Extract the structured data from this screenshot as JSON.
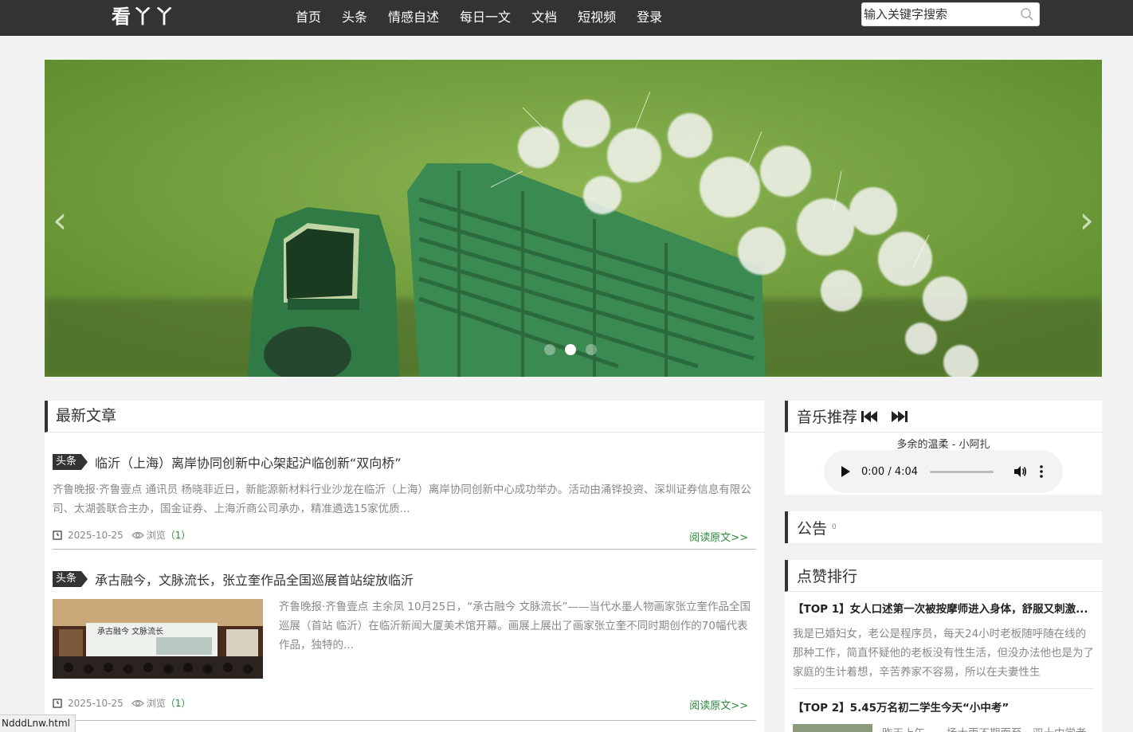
{
  "header": {
    "logo": "看丫丫",
    "nav": [
      "首页",
      "头条",
      "情感自述",
      "每日一文",
      "文档",
      "短视频",
      "登录"
    ],
    "search": {
      "placeholder": "输入关键字搜索"
    }
  },
  "slider": {
    "prev": "‹",
    "next": "›",
    "dot_count": 3,
    "active_dot": 2
  },
  "latest": {
    "title": "最新文章",
    "articles": [
      {
        "tag": "头条",
        "title": "临沂（上海）离岸协同创新中心架起沪临创新“双向桥”",
        "summary": "齐鲁晚报·齐鲁壹点 通讯员 杨晓菲近日，新能源新材料行业沙龙在临沂（上海）离岸协同创新中心成功举办。活动由涌铧投资、深圳证券信息有限公司、太湖荟联合主办，国金证券、上海沂商公司承办，精准遴选15家优质...",
        "date": "2025-10-25",
        "views_label": "浏览",
        "views": "（1）",
        "read_more": "阅读原文>>"
      },
      {
        "tag": "头条",
        "title": "承古融今，文脉流长，张立奎作品全国巡展首站绽放临沂",
        "summary": "齐鲁晚报·齐鲁壹点 主余凤 10月25日，“承古融今 文脉流长”——当代水墨人物画家张立奎作品全国巡展（首站 临沂）在临沂新闻大厦美术馆开幕。画展上展出了画家张立奎不同时期创作的70幅代表作品，独特的...",
        "date": "2025-10-25",
        "views_label": "浏览",
        "views": "（1）",
        "read_more": "阅读原文>>",
        "thumb_text": "承古融今 文脉流长"
      }
    ]
  },
  "music": {
    "title": "音乐推荐",
    "song": "多余的温柔 - 小阿扎",
    "time": "0:00 / 4:04"
  },
  "notice": {
    "title": "公告",
    "badge": "0"
  },
  "ranking": {
    "title": "点赞排行",
    "items": [
      {
        "title": "【TOP 1】女人口述第一次被按摩师进入身体，舒服又刺激...",
        "summary": "我是已婚妇女，老公是程序员，每天24小时老板随呼随在线的那种工作，简直怀疑他的老板没有性生活，但没办法他也是为了家庭的生计着想，辛苦养家不容易，所以在夫妻性生"
      },
      {
        "title": "【TOP 2】5.45万名初二学生今天“小中考”",
        "summary": "昨天上午，一场大雨不期而至，双十中学老"
      }
    ]
  },
  "status": {
    "url": "NdddLnw.html"
  },
  "colors": {
    "nav_bg": "#333333",
    "link_green": "#2a8a3a",
    "muted": "#888888"
  }
}
